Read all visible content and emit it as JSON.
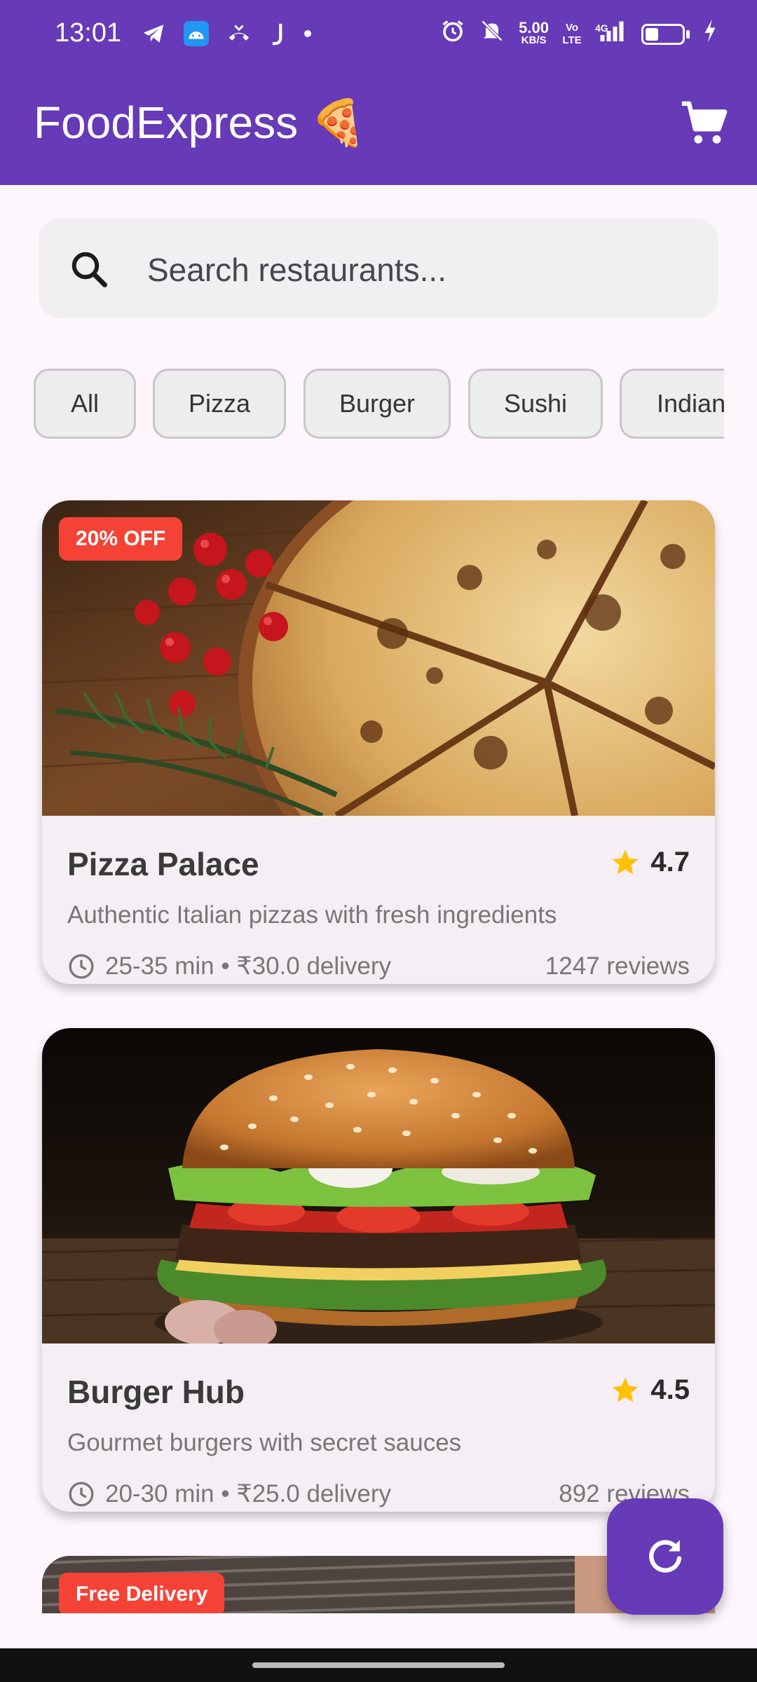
{
  "status_bar": {
    "time": "13:01",
    "network_speed_value": "5.00",
    "network_speed_unit": "KB/S",
    "volte": "Vo LTE",
    "network_type": "4G",
    "battery_level": 0.35,
    "icons_left": [
      "telegram-icon",
      "android-icon",
      "missed-call-icon",
      "j-app-icon",
      "dot-icon"
    ],
    "icons_right": [
      "alarm-icon",
      "mute-icon",
      "signal-icon",
      "battery-icon",
      "charging-icon"
    ]
  },
  "app_bar": {
    "title": "FoodExpress",
    "title_emoji": "🍕",
    "cart_icon": "cart-icon",
    "color": "#673ab7"
  },
  "search": {
    "placeholder": "Search restaurants..."
  },
  "categories": [
    "All",
    "Pizza",
    "Burger",
    "Sushi",
    "Indian"
  ],
  "restaurants": [
    {
      "name": "Pizza Palace",
      "rating": "4.7",
      "description": "Authentic Italian pizzas with fresh ingredients",
      "delivery_info": "25-35 min • ₹30.0 delivery",
      "reviews": "1247 reviews",
      "badge": "20% OFF"
    },
    {
      "name": "Burger Hub",
      "rating": "4.5",
      "description": "Gourmet burgers with secret sauces",
      "delivery_info": "20-30 min • ₹25.0 delivery",
      "reviews": "892 reviews"
    },
    {
      "badge": "Free Delivery"
    }
  ],
  "colors": {
    "accent": "#673ab7",
    "badge": "#f44336",
    "star": "#ffc107"
  },
  "fab_icon": "refresh-icon"
}
